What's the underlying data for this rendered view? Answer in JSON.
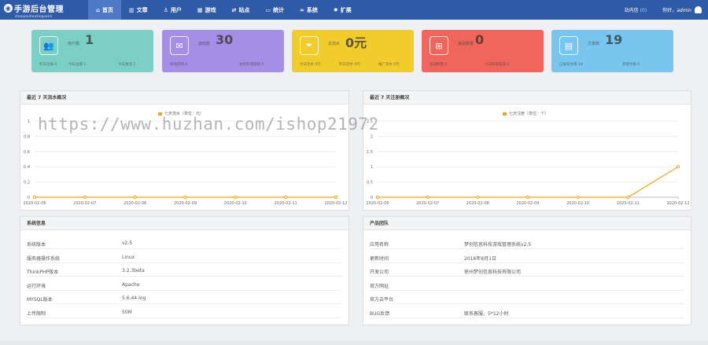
{
  "topbar": {
    "logo_title": "手游后台管理",
    "logo_sub": "shouyouhoutaiguanli",
    "nav": [
      {
        "label": "首页",
        "icon": "home-icon",
        "glyph": "⌂"
      },
      {
        "label": "文章",
        "icon": "bar-chart-icon",
        "glyph": "▥"
      },
      {
        "label": "用户",
        "icon": "user-icon",
        "glyph": "♙"
      },
      {
        "label": "游戏",
        "icon": "grid-icon",
        "glyph": "▦"
      },
      {
        "label": "站点",
        "icon": "shuffle-icon",
        "glyph": "⇄"
      },
      {
        "label": "统计",
        "icon": "monitor-icon",
        "glyph": "▭"
      },
      {
        "label": "系统",
        "icon": "link-icon",
        "glyph": "∞"
      },
      {
        "label": "扩展",
        "icon": "gear-icon",
        "glyph": "✹"
      }
    ],
    "msg_label": "站内信",
    "msg_count": "(0)",
    "greeting": "你好，",
    "username": "admin"
  },
  "cards": [
    {
      "label": "用户数",
      "value": "1",
      "color": "#7ccfc5",
      "icon": "users-icon",
      "glyph": "👥",
      "subs": [
        "昨日注册 0",
        "今日注册 1",
        "今日激活 1"
      ]
    },
    {
      "label": "游戏数",
      "value": "30",
      "color": "#a58ee6",
      "icon": "gamepad-icon",
      "glyph": "✉",
      "subs": [
        "新增游戏 0",
        "本月新增游戏 0"
      ]
    },
    {
      "label": "总流水",
      "value": "0元",
      "color": "#f2cc2c",
      "icon": "filter-icon",
      "glyph": "⏷",
      "subs": [
        "今日流水 0元",
        "昨日流水 0元",
        "推广流水 0元"
      ]
    },
    {
      "label": "渠道数量",
      "value": "0",
      "color": "#f0665d",
      "icon": "sitemap-icon",
      "glyph": "⊞",
      "subs": [
        "渠道数量 0",
        "今日新增渠道 0"
      ]
    },
    {
      "label": "文章数",
      "value": "19",
      "color": "#78c5ef",
      "icon": "document-icon",
      "glyph": "▤",
      "subs": [
        "已发布文章 19",
        "新增文章 0"
      ]
    }
  ],
  "charts": {
    "flow": {
      "title": "最近 7 天流水概况",
      "chart_data": {
        "type": "line",
        "x": [
          "2020-02-06",
          "2020-02-07",
          "2020-02-08",
          "2020-02-09",
          "2020-02-10",
          "2020-02-11",
          "2020-02-12"
        ],
        "series": [
          {
            "name": "七天流水（单位：元）",
            "values": [
              0,
              0,
              0,
              0,
              0,
              0,
              0
            ],
            "color": "#f0a31a"
          }
        ],
        "yticks": [
          "0",
          "0.2",
          "0.4",
          "0.6",
          "0.8",
          "1"
        ],
        "ylim": [
          0,
          1
        ],
        "grid": true,
        "legend": "top-center"
      }
    },
    "register": {
      "title": "最近 7 天注册概况",
      "chart_data": {
        "type": "line",
        "x": [
          "2020-02-06",
          "2020-02-07",
          "2020-02-08",
          "2020-02-09",
          "2020-02-10",
          "2020-02-11",
          "2020-02-12"
        ],
        "series": [
          {
            "name": "七天注册（单位：个）",
            "values": [
              0,
              0,
              0,
              0,
              0,
              0,
              1
            ],
            "color": "#f0a31a"
          }
        ],
        "yticks": [
          "0",
          "0.5",
          "1",
          "1.5",
          "2",
          "2.5"
        ],
        "ylim": [
          0,
          2.5
        ],
        "grid": true,
        "legend": "top-center"
      }
    }
  },
  "system_info": {
    "title": "系统信息",
    "rows": [
      {
        "k": "系统版本",
        "v": "v2.5"
      },
      {
        "k": "服务器操作系统",
        "v": "Linux"
      },
      {
        "k": "ThinkPHP版本",
        "v": "3.2.3beta"
      },
      {
        "k": "运行环境",
        "v": "Apache"
      },
      {
        "k": "MYSQL版本",
        "v": "5.6.44-log"
      },
      {
        "k": "上传限制",
        "v": "50M"
      }
    ]
  },
  "product_team": {
    "title": "产品团队",
    "rows": [
      {
        "k": "应用名称",
        "v": "梦创信息科技游戏管理系统v2.5"
      },
      {
        "k": "更新时间",
        "v": "2016年8月1日"
      },
      {
        "k": "开发公司",
        "v": "徐州梦创信息科技有限公司"
      },
      {
        "k": "官方网址",
        "v": ""
      },
      {
        "k": "官方云平台",
        "v": ""
      },
      {
        "k": "BUG反馈",
        "v": "联系客服，5*12小时"
      }
    ]
  },
  "watermark": "https://www.huzhan.com/ishop21972"
}
